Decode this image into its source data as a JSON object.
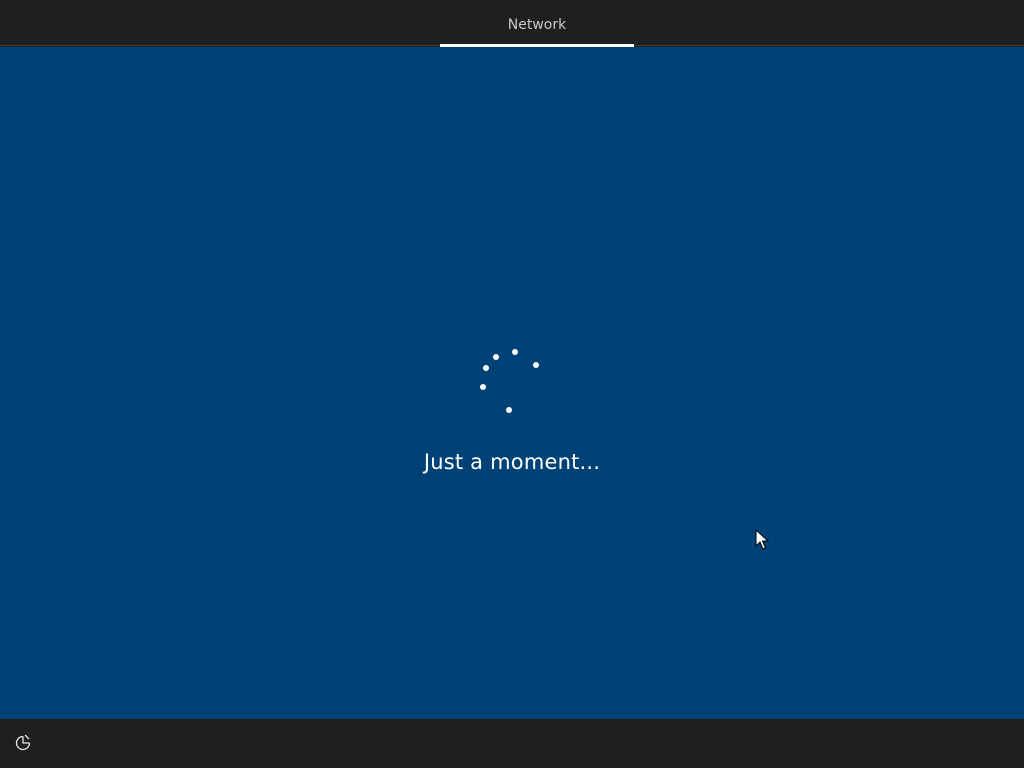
{
  "header": {
    "tabs": [
      {
        "label": "Network",
        "active": true
      }
    ]
  },
  "main": {
    "status_text": "Just a moment...",
    "background_color": "#004275",
    "spinner": {
      "icon": "loading-spinner-icon"
    }
  },
  "footer": {
    "accessibility_button": {
      "icon": "ease-of-access-icon"
    }
  },
  "cursor": {
    "icon": "mouse-pointer-icon"
  }
}
